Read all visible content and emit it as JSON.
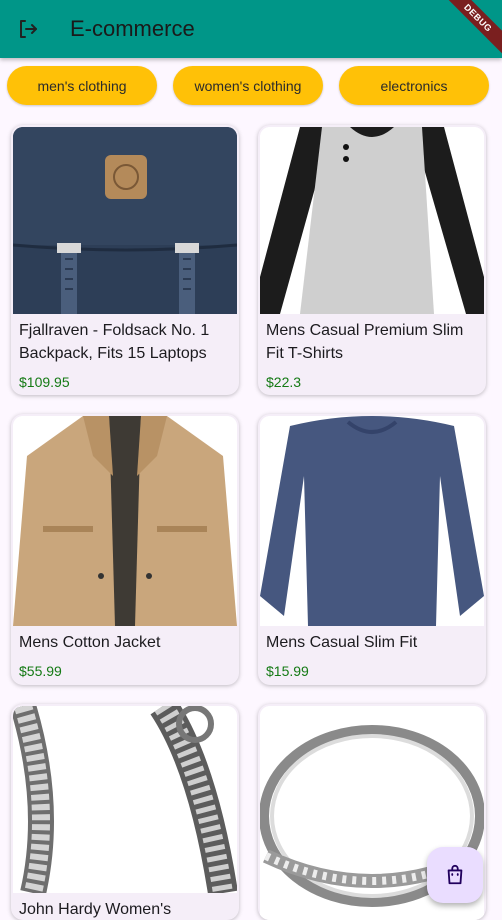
{
  "app": {
    "title": "E-commerce",
    "debug_banner": "DEBUG"
  },
  "categories": [
    "men's clothing",
    "women's clothing",
    "electronics"
  ],
  "products": [
    {
      "name": "Fjallraven - Foldsack No. 1 Backpack, Fits 15 Laptops",
      "price": "$109.95",
      "image": "backpack"
    },
    {
      "name": "Mens Casual Premium Slim Fit T-Shirts",
      "price": "$22.3",
      "image": "raglan-shirt"
    },
    {
      "name": "Mens Cotton Jacket",
      "price": "$55.99",
      "image": "cotton-jacket"
    },
    {
      "name": "Mens Casual Slim Fit",
      "price": "$15.99",
      "image": "long-sleeve-shirt"
    },
    {
      "name": "John Hardy Women's",
      "price": "",
      "image": "chain-bracelet"
    },
    {
      "name": "",
      "price": "",
      "image": "ring"
    }
  ],
  "fab": {
    "icon": "shopping-bag-icon"
  },
  "colors": {
    "appbar": "#009688",
    "chip": "#ffc107",
    "price": "#157a15",
    "fab": "#eaddff",
    "background": "#fdf7ff"
  }
}
